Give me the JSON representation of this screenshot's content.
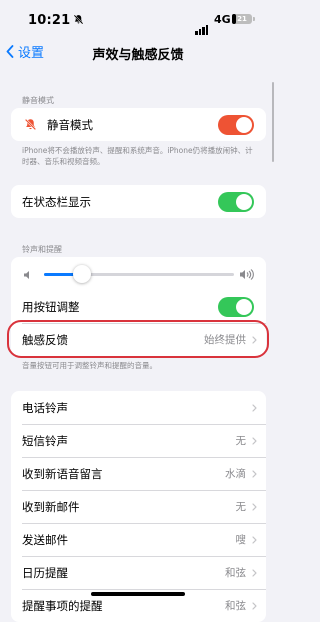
{
  "status_bar": {
    "time": "10:21",
    "network": "4G",
    "battery": "21",
    "battery_fraction": 0.21
  },
  "nav": {
    "back_label": "设置",
    "title": "声效与触感反馈"
  },
  "silent_section": {
    "header": "静音模式",
    "row_label": "静音模式",
    "toggle_on": true,
    "toggle_color": "#ee5334",
    "footer": "iPhone将不会播放铃声、提醒和系统声音。iPhone仍将播放闹钟、计时器、音乐和视频音频。"
  },
  "status_bar_row": {
    "label": "在状态栏显示",
    "toggle_on": true,
    "toggle_color": "#34c759"
  },
  "ringer_section": {
    "header": "铃声和提醒",
    "volume_level": 0.2,
    "button_adjust_label": "用按钮调整",
    "button_adjust_on": true,
    "haptics_label": "触感反馈",
    "haptics_value": "始终提供",
    "footer": "音量按钮可用于调整铃声和提醒的音量。"
  },
  "sounds": [
    {
      "label": "电话铃声",
      "value": ""
    },
    {
      "label": "短信铃声",
      "value": "无"
    },
    {
      "label": "收到新语音留言",
      "value": "水滴"
    },
    {
      "label": "收到新邮件",
      "value": "无"
    },
    {
      "label": "发送邮件",
      "value": "嗖"
    },
    {
      "label": "日历提醒",
      "value": "和弦"
    },
    {
      "label": "提醒事项的提醒",
      "value": "和弦"
    }
  ],
  "colors": {
    "accent": "#0a7aff",
    "highlight_stroke": "#d9333c"
  }
}
